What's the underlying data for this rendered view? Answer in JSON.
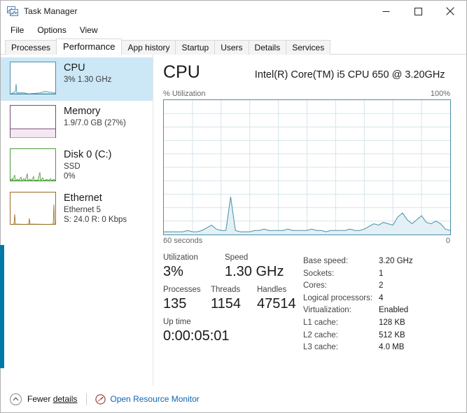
{
  "window": {
    "title": "Task Manager",
    "icon": "task-manager-icon",
    "caption": {
      "minimize": "minimize-icon",
      "maximize": "maximize-icon",
      "close": "close-icon"
    }
  },
  "menu": {
    "items": [
      {
        "label": "File"
      },
      {
        "label": "Options"
      },
      {
        "label": "View"
      }
    ]
  },
  "tabs": {
    "active": "Performance",
    "items": [
      {
        "label": "Processes"
      },
      {
        "label": "Performance"
      },
      {
        "label": "App history"
      },
      {
        "label": "Startup"
      },
      {
        "label": "Users"
      },
      {
        "label": "Details"
      },
      {
        "label": "Services"
      }
    ]
  },
  "sidebar": {
    "items": [
      {
        "title": "CPU",
        "sub1": "3%  1.30 GHz",
        "sub2": "",
        "selected": true,
        "color": "#4a8fa8"
      },
      {
        "title": "Memory",
        "sub1": "1.9/7.0 GB (27%)",
        "sub2": "",
        "selected": false,
        "color": "#7a4b78"
      },
      {
        "title": "Disk 0 (C:)",
        "sub1": "SSD",
        "sub2": "0%",
        "selected": false,
        "color": "#4e9a3a"
      },
      {
        "title": "Ethernet",
        "sub1": "Ethernet 5",
        "sub2": "S: 24.0 R: 0 Kbps",
        "selected": false,
        "color": "#9a6b24"
      }
    ]
  },
  "main": {
    "heading": "CPU",
    "model": "Intel(R) Core(TM) i5 CPU 650 @ 3.20GHz",
    "graph_axis_left": "% Utilization",
    "graph_axis_right": "100%",
    "graph_foot_left": "60 seconds",
    "graph_foot_right": "0",
    "stats": {
      "utilization_label": "Utilization",
      "utilization_value": "3%",
      "speed_label": "Speed",
      "speed_value": "1.30 GHz",
      "processes_label": "Processes",
      "processes_value": "135",
      "threads_label": "Threads",
      "threads_value": "1154",
      "handles_label": "Handles",
      "handles_value": "47514",
      "uptime_label": "Up time",
      "uptime_value": "0:00:05:01"
    },
    "specs": [
      {
        "key": "Base speed:",
        "value": "3.20 GHz"
      },
      {
        "key": "Sockets:",
        "value": "1"
      },
      {
        "key": "Cores:",
        "value": "2"
      },
      {
        "key": "Logical processors:",
        "value": "4"
      },
      {
        "key": "Virtualization:",
        "value": "Enabled"
      },
      {
        "key": "L1 cache:",
        "value": "128 KB"
      },
      {
        "key": "L2 cache:",
        "value": "512 KB"
      },
      {
        "key": "L3 cache:",
        "value": "4.0 MB"
      }
    ]
  },
  "footer": {
    "fewer_details": "Fewer details",
    "fewer_details_icon": "chevron-up-circle-icon",
    "open_resource_monitor": "Open Resource Monitor",
    "resource_monitor_icon": "resource-monitor-icon"
  },
  "colors": {
    "accent": "#0078a8",
    "cpu_line": "#4a8fa8",
    "cpu_fill": "#e3f0f5",
    "selection": "#cce8f7",
    "link": "#0b67b5"
  },
  "chart_data": {
    "type": "area",
    "title": "% Utilization",
    "xlabel": "60 seconds",
    "ylabel": "% Utilization",
    "ylim": [
      0,
      100
    ],
    "xlim": [
      60,
      0
    ],
    "grid": true,
    "grid_cols": 10,
    "grid_rows": 10,
    "series": [
      {
        "name": "CPU utilization",
        "color": "#4a8fa8",
        "values": [
          2,
          2,
          2,
          2,
          2,
          3,
          2,
          2,
          3,
          5,
          7,
          4,
          3,
          3,
          28,
          3,
          2,
          2,
          2,
          3,
          3,
          4,
          3,
          3,
          3,
          3,
          4,
          3,
          3,
          3,
          3,
          4,
          3,
          3,
          2,
          3,
          3,
          3,
          3,
          4,
          3,
          3,
          4,
          6,
          8,
          7,
          9,
          8,
          7,
          13,
          16,
          11,
          8,
          11,
          14,
          9,
          8,
          10,
          8,
          4,
          3
        ]
      }
    ]
  }
}
